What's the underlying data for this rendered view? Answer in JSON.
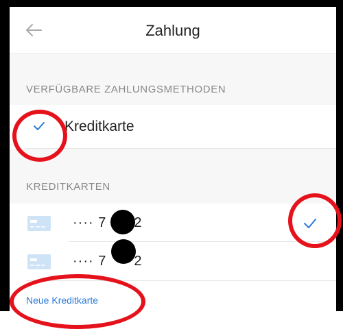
{
  "navbar": {
    "title": "Zahlung",
    "back_icon": "arrow-left-icon"
  },
  "payment_methods": {
    "header": "VERFÜGBARE ZAHLUNGSMETHODEN",
    "items": [
      {
        "label": "Kreditkarte",
        "selected": true
      }
    ]
  },
  "credit_cards": {
    "header": "KREDITKARTEN",
    "items": [
      {
        "number": "···· 7",
        "suffix": "2",
        "selected": true
      },
      {
        "number": "···· 7",
        "suffix": "2",
        "selected": false
      }
    ],
    "add_link": "Neue Kreditkarte"
  },
  "colors": {
    "accent": "#2a7ad6",
    "annotation": "#e5121c",
    "card_icon": "#cfe3f7"
  }
}
